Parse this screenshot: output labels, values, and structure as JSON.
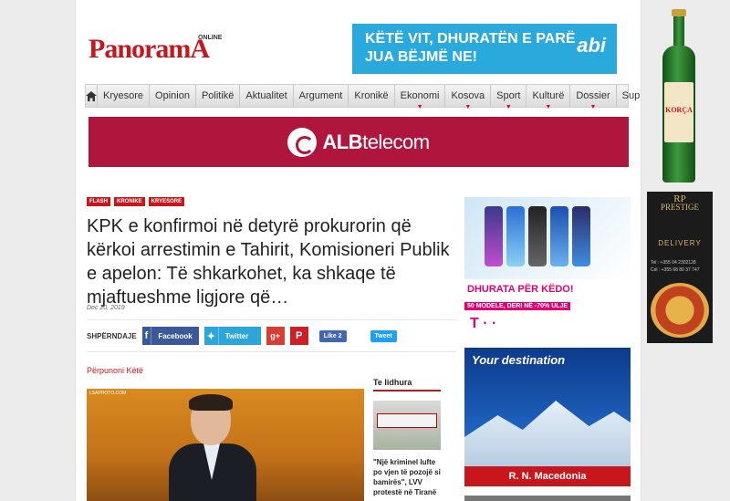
{
  "logo": {
    "text": "PanoramA",
    "online": "ONLINE"
  },
  "top_ad": {
    "line1": "KËTË VIT, DHURATËN E PARË",
    "line2": "JUA BËJMË NE!",
    "brand": "abi"
  },
  "nav": {
    "home_icon": "home-icon",
    "items": [
      {
        "label": "Kryesore",
        "caret": false
      },
      {
        "label": "Opinion",
        "caret": false
      },
      {
        "label": "Politikë",
        "caret": false
      },
      {
        "label": "Aktualitet",
        "caret": false
      },
      {
        "label": "Argument",
        "caret": false
      },
      {
        "label": "Kronikë",
        "caret": false
      },
      {
        "label": "Ekonomi",
        "caret": true
      },
      {
        "label": "Kosova",
        "caret": true
      },
      {
        "label": "Sport",
        "caret": true
      },
      {
        "label": "Kulturë",
        "caret": true
      },
      {
        "label": "Dossier",
        "caret": true
      },
      {
        "label": "Suplemente",
        "caret": true
      }
    ]
  },
  "alb_banner": {
    "brand_bold": "ALB",
    "brand_rest": "telecom"
  },
  "article": {
    "tags": [
      "FLASH",
      "KRONIKE",
      "KRYESORE"
    ],
    "headline": "KPK e konfirmoi në detyrë prokurorin që kërkoi arrestimin e Tahirit, Komisioneri Publik e apelon: Të shkarkohet, ka shkaqe të mjaftueshme ligjore që…",
    "date": "Dec 20, 2019",
    "share_label": "SHPËRNDAJE",
    "facebook_label": "Facebook",
    "twitter_label": "Twitter",
    "googleplus_label": "g+",
    "pinterest_label": "P",
    "like_label": "Like 2",
    "tweet_label": "Tweet",
    "perpunoni": "Përpunoni Këtë",
    "photo_caption": "LSAPHOTO.COM"
  },
  "related": {
    "heading": "Te lidhura",
    "sign_text": "kriminel lufte po vjen të pozojë si bamirës",
    "text": "\"Një kriminel lufte po vjen të pozojë si bamirës\", LVV protestë në Tiranë"
  },
  "side_ads": {
    "telekom_title": "DHURATA PËR KËDO!",
    "telekom_sub": "50 MODELE, DERI NË -70% ULJE",
    "telekom_logo": "T · ·",
    "macedonia_title": "Your destination",
    "macedonia_bar": "R. N. Macedonia"
  },
  "right_ads": {
    "beer_word": "KORÇA",
    "prestige_rp": "RP",
    "prestige_name": "PRESTIGE",
    "prestige_delivery": "DELIVERY",
    "prestige_tel": "Tel : +355 04 2302128",
    "prestige_cel": "Cel : +355 68 80 37 747"
  },
  "colors": {
    "brand_red": "#c8161d",
    "alb_red": "#b0163d",
    "telekom_magenta": "#e20074",
    "abi_blue": "#2aa9dd"
  }
}
